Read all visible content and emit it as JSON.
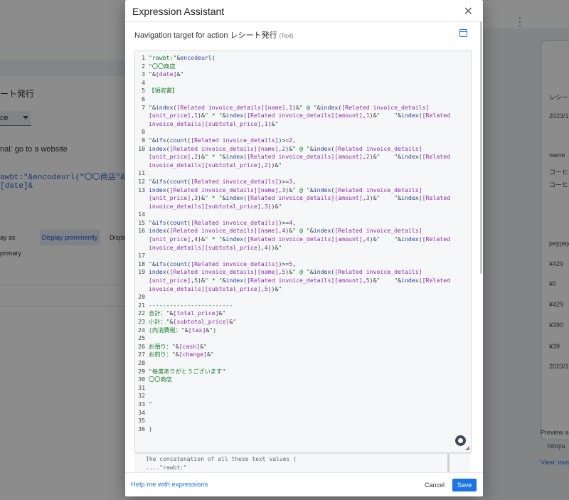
{
  "background": {
    "page_title": "ート発行",
    "select_value": "ce",
    "nav_text": "nal: go to a website",
    "expression_preview": "awbt:\"&encodeurl(\"〇〇商店\"&[date]&",
    "tabs": [
      "ay as primary",
      "Display prominently",
      "Displa"
    ],
    "phone": {
      "title": "レシート",
      "labels": [
        "2023/1",
        "name",
        "コーヒー",
        "コーヒー",
        "paypay",
        "¥429",
        "¥0",
        "¥429",
        "¥390",
        "¥39",
        "2023/1"
      ],
      "preview_app": "Preview app",
      "user": "hiroyu",
      "view": "View: invoice_"
    }
  },
  "dialog": {
    "title": "Expression Assistant",
    "close_label": "✕",
    "nav_label": "Navigation target for action レシート発行",
    "nav_type": "(Text)",
    "help_link": "Help me with expressions",
    "cancel": "Cancel",
    "save": "Save",
    "preview_line1": "The concatenation of all these text values (",
    "preview_line2": "....\"rawbt:\""
  },
  "code_lines": [
    "1",
    "2",
    "3",
    "4",
    "5",
    "6",
    "7",
    "",
    "",
    "8",
    "9",
    "10",
    "",
    "",
    "11",
    "12",
    "13",
    "",
    "",
    "14",
    "15",
    "16",
    "",
    "",
    "17",
    "18",
    "19",
    "",
    "",
    "20",
    "21",
    "22",
    "23",
    "24",
    "25",
    "26",
    "27",
    "28",
    "29",
    "30",
    "31",
    "32",
    "33",
    "34",
    "35",
    "36"
  ]
}
